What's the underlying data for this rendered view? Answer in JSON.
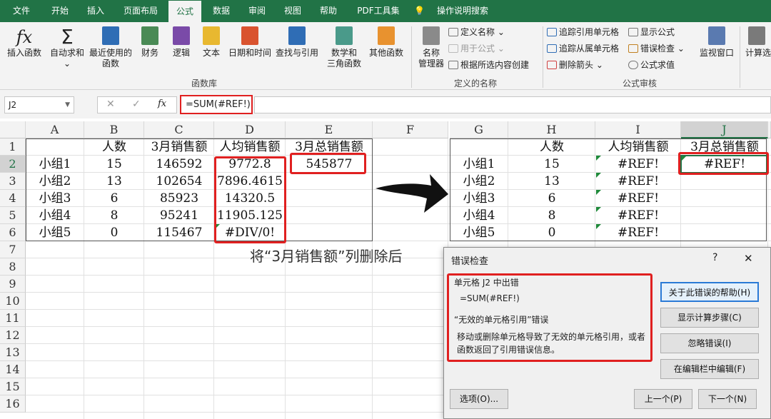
{
  "tabs": [
    "文件",
    "开始",
    "插入",
    "页面布局",
    "公式",
    "数据",
    "审阅",
    "视图",
    "帮助",
    "PDF工具集",
    "操作说明搜索"
  ],
  "ribbon": {
    "insert_fn": "插入函数",
    "autosum": "自动求和",
    "recent": "最近使用的",
    "recent2": "函数",
    "finance": "财务",
    "logic": "逻辑",
    "text": "文本",
    "datetime": "日期和时间",
    "lookup": "查找与引用",
    "math1": "数学和",
    "math2": "三角函数",
    "other": "其他函数",
    "fnlib": "函数库",
    "namemgr1": "名称",
    "namemgr2": "管理器",
    "define_name": "定义名称",
    "use_in_formula": "用于公式",
    "create_from_sel": "根据所选内容创建",
    "defined_names": "定义的名称",
    "trace_prec": "追踪引用单元格",
    "trace_dep": "追踪从属单元格",
    "remove_arrows": "删除箭头",
    "show_formulas": "显示公式",
    "error_check": "错误检查",
    "eval_formula": "公式求值",
    "audit": "公式审核",
    "watch": "监视窗口",
    "calc": "计算选"
  },
  "formula_bar": {
    "name": "J2",
    "fx": "fx",
    "cancel": "✕",
    "enter": "✓",
    "formula": "=SUM(#REF!)"
  },
  "left_cols": [
    "A",
    "B",
    "C",
    "D",
    "E",
    "F"
  ],
  "right_cols": [
    "G",
    "H",
    "I",
    "J"
  ],
  "rows": [
    "1",
    "2",
    "3",
    "4",
    "5",
    "6",
    "7",
    "8",
    "9",
    "10",
    "11",
    "12",
    "13",
    "14",
    "15",
    "16"
  ],
  "left_header": [
    "",
    "人数",
    "3月销售额",
    "人均销售额",
    "3月总销售额"
  ],
  "left_data": [
    [
      "小组1",
      "15",
      "146592",
      "9772.8",
      "545877"
    ],
    [
      "小组2",
      "13",
      "102654",
      "7896.4615",
      ""
    ],
    [
      "小组3",
      "6",
      "85923",
      "14320.5",
      ""
    ],
    [
      "小组4",
      "8",
      "95241",
      "11905.125",
      ""
    ],
    [
      "小组5",
      "0",
      "115467",
      "#DIV/0!",
      ""
    ]
  ],
  "right_header": [
    "",
    "人数",
    "人均销售额",
    "3月总销售额"
  ],
  "right_data": [
    [
      "小组1",
      "15",
      "#REF!",
      "#REF!"
    ],
    [
      "小组2",
      "13",
      "#REF!",
      ""
    ],
    [
      "小组3",
      "6",
      "#REF!",
      ""
    ],
    [
      "小组4",
      "8",
      "#REF!",
      ""
    ],
    [
      "小组5",
      "0",
      "#REF!",
      ""
    ]
  ],
  "caption": "将“3月销售额”列删除后",
  "dialog": {
    "title": "错误检查",
    "help": "?",
    "close": "✕",
    "cell_err": "单元格 J2 中出错",
    "formula": "=SUM(#REF!)",
    "err_type": "“无效的单元格引用”错误",
    "desc1": "移动或删除单元格导致了无效的单元格引用，或者",
    "desc2": "函数返回了引用错误信息。",
    "btn_help": "关于此错误的帮助(H)",
    "btn_steps": "显示计算步骤(C)",
    "btn_ignore": "忽略错误(I)",
    "btn_edit": "在编辑栏中编辑(F)",
    "btn_options": "选项(O)...",
    "btn_prev": "上一个(P)",
    "btn_next": "下一个(N)"
  }
}
